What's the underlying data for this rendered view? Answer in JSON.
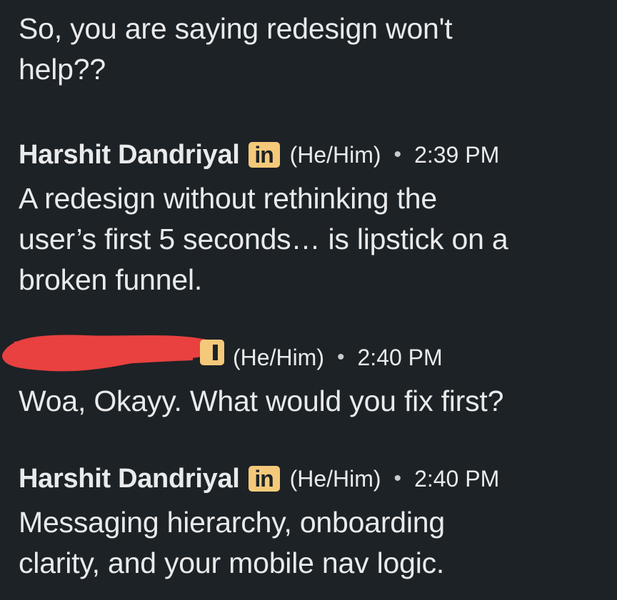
{
  "messages": [
    {
      "text_lines": [
        "So, you are saying redesign won't",
        "help??"
      ]
    },
    {
      "sender": "Harshit Dandriyal",
      "badge": "in",
      "pronouns": "(He/Him)",
      "separator": "•",
      "time": "2:39 PM",
      "text_lines": [
        "A redesign without rethinking the",
        "user’s first 5 seconds… is lipstick on a",
        "broken funnel."
      ]
    },
    {
      "sender_redacted": true,
      "pronouns": "(He/Him)",
      "separator": "•",
      "time": "2:40 PM",
      "text_lines": [
        "Woa, Okayy. What would you fix first?"
      ]
    },
    {
      "sender": "Harshit Dandriyal",
      "badge": "in",
      "pronouns": "(He/Him)",
      "separator": "•",
      "time": "2:40 PM",
      "text_lines": [
        "Messaging hierarchy, onboarding",
        "clarity, and your mobile nav logic."
      ]
    }
  ],
  "colors": {
    "background": "#1d2226",
    "text": "#e9eaeb",
    "linkedin_badge": "#f5c97a",
    "redaction": "#e8413f"
  },
  "icons": {
    "badge": "linkedin-badge-icon",
    "redaction": "red-scribble-redaction"
  }
}
